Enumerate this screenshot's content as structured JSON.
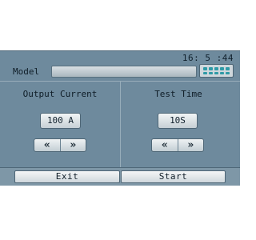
{
  "status": {
    "time": "16: 5 :44"
  },
  "model": {
    "label": "Model",
    "value": ""
  },
  "keypad": {
    "icon": "keypad-icon"
  },
  "output_current": {
    "title": "Output Current",
    "value": "100 A",
    "decrease_label": "«",
    "increase_label": "»"
  },
  "test_time": {
    "title": "Test Time",
    "value": "10S",
    "decrease_label": "«",
    "increase_label": "»"
  },
  "actions": {
    "exit_label": "Exit",
    "start_label": "Start"
  },
  "colors": {
    "screen_bg": "#6e8a9d",
    "keypad_dots": "#2f9aa6"
  }
}
